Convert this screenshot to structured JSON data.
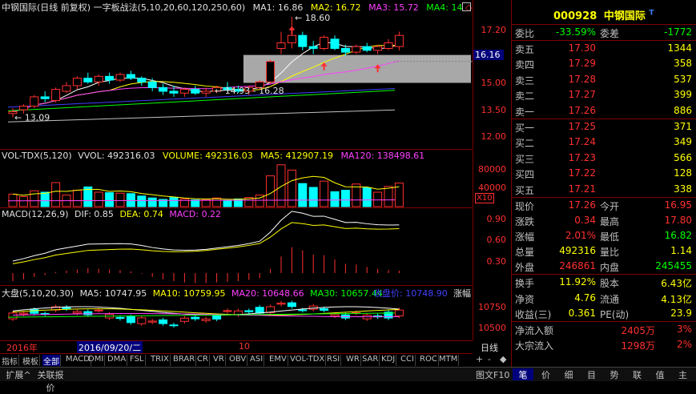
{
  "colors": {
    "up": "#ff3030",
    "down": "#00ffff",
    "ma5": "#ffffff",
    "ma10": "#ffff00",
    "ma20": "#ff40ff",
    "ma60": "#00ff00",
    "ma120": "#4040ff",
    "ma250": "#c0c0c0",
    "grid": "#800000"
  },
  "price_pane": {
    "header": "中钢国际(日线 前复权) 一字板战法(5,10,20,60,120,250,60)",
    "ma1": "MA1: 16.86",
    "ma2": "MA2: 16.72",
    "ma3": "MA3: 15.72",
    "ma4": "MA4: 14",
    "hi_label": "18.60",
    "range_label": "14.93 - 16.28",
    "low_label": "13.09",
    "current_tag": "16.16",
    "y_ticks": [
      "17.20",
      "16.16",
      "15.00",
      "13.50",
      "12.00"
    ]
  },
  "vol_pane": {
    "header": "VOL-TDX(5,120)",
    "vvol": "VVOL: 492316.03",
    "volume": "VOLUME: 492316.03",
    "ma5": "MA5: 412907.19",
    "ma120": "MA120: 138498.61",
    "y_ticks": [
      "80000",
      "40000"
    ],
    "unit": "X10"
  },
  "macd_pane": {
    "header": "MACD(12,26,9)",
    "dif": "DIF: 0.85",
    "dea": "DEA: 0.74",
    "macd": "MACD: 0.22",
    "y_ticks": [
      "0.90",
      "0.60",
      "0.30"
    ]
  },
  "index_pane": {
    "header": "大盘(5,10,20,30)",
    "ma5": "MA5: 10747.95",
    "ma10": "MA10: 10759.95",
    "ma20": "MA20: 10648.66",
    "ma30": "MA30: 10657.44",
    "close_label": "收盘价: 10748.90",
    "tail": "涨幅",
    "y_ticks": [
      "10750",
      "10500"
    ]
  },
  "time_axis": {
    "year": "2016年",
    "cursor_date": "2016/09/20/二",
    "month": "10",
    "period": "日线"
  },
  "indicator_tabs": [
    "指标",
    "模板",
    "全部",
    "MACD",
    "DMI",
    "DMA",
    "FSL",
    "TRIX",
    "BRAR",
    "CR",
    "VR",
    "OBV",
    "ASI",
    "EMV",
    "VOL-TDX",
    "RSI",
    "WR",
    "SAR",
    "KDJ",
    "CCI",
    "ROC",
    "MTM"
  ],
  "tab_controls": [
    "+",
    "-",
    "◆"
  ],
  "bottom_left": [
    "扩展^",
    "关联报价"
  ],
  "bottom_right_label": "图文F10",
  "bottom_tabs": [
    "笔",
    "价",
    "细",
    "目",
    "势",
    "联",
    "值",
    "主"
  ],
  "quote": {
    "code": "000928",
    "name": "中钢国际",
    "flag": "T",
    "weibi_label": "委比",
    "weibi": "-33.59%",
    "weicha_label": "委差",
    "weicha": "-1772",
    "asks": [
      {
        "label": "卖五",
        "price": "17.30",
        "vol": "1344"
      },
      {
        "label": "卖四",
        "price": "17.29",
        "vol": "358"
      },
      {
        "label": "卖三",
        "price": "17.28",
        "vol": "537"
      },
      {
        "label": "卖二",
        "price": "17.27",
        "vol": "399"
      },
      {
        "label": "卖一",
        "price": "17.26",
        "vol": "886"
      }
    ],
    "bids": [
      {
        "label": "买一",
        "price": "17.25",
        "vol": "371"
      },
      {
        "label": "买二",
        "price": "17.24",
        "vol": "349"
      },
      {
        "label": "买三",
        "price": "17.23",
        "vol": "566"
      },
      {
        "label": "买四",
        "price": "17.22",
        "vol": "128"
      },
      {
        "label": "买五",
        "price": "17.21",
        "vol": "338"
      }
    ],
    "stats": [
      {
        "l1": "现价",
        "v1": "17.26",
        "l2": "今开",
        "v2": "16.95",
        "c1": "#ff3030",
        "c2": "#ff3030"
      },
      {
        "l1": "涨跌",
        "v1": "0.34",
        "l2": "最高",
        "v2": "17.80",
        "c1": "#ff3030",
        "c2": "#ff3030"
      },
      {
        "l1": "涨幅",
        "v1": "2.01%",
        "l2": "最低",
        "v2": "16.82",
        "c1": "#ff3030",
        "c2": "#00ff00"
      },
      {
        "l1": "总量",
        "v1": "492316",
        "l2": "量比",
        "v2": "1.14",
        "c1": "#ffff00",
        "c2": "#ffff00"
      },
      {
        "l1": "外盘",
        "v1": "246861",
        "l2": "内盘",
        "v2": "245455",
        "c1": "#ff3030",
        "c2": "#00ff00"
      }
    ],
    "stats2": [
      {
        "l1": "换手",
        "v1": "11.92%",
        "l2": "股本",
        "v2": "6.43亿"
      },
      {
        "l1": "净资",
        "v1": "4.76",
        "l2": "流通",
        "v2": "4.13亿"
      },
      {
        "l1": "收益(三)",
        "v1": "0.361",
        "l2": "PE(动)",
        "v2": "23.9"
      }
    ],
    "flows": [
      {
        "label": "净流入额",
        "value": "2405万",
        "pct": "3%"
      },
      {
        "label": "大宗流入",
        "value": "1298万",
        "pct": "2%"
      }
    ]
  },
  "chart_data": [
    {
      "type": "candlestick",
      "name": "中钢国际 daily",
      "ohlc": [
        [
          13.4,
          13.7,
          13.2,
          13.5
        ],
        [
          13.6,
          13.9,
          13.4,
          13.8
        ],
        [
          13.8,
          14.4,
          13.7,
          14.3
        ],
        [
          14.3,
          14.6,
          14.0,
          14.2
        ],
        [
          14.1,
          14.8,
          14.0,
          14.7
        ],
        [
          14.6,
          15.1,
          14.5,
          14.9
        ],
        [
          14.9,
          15.4,
          14.7,
          15.3
        ],
        [
          15.3,
          15.6,
          15.0,
          15.1
        ],
        [
          15.1,
          15.5,
          14.9,
          15.4
        ],
        [
          15.4,
          15.6,
          15.0,
          15.2
        ],
        [
          15.2,
          15.6,
          15.1,
          15.5
        ],
        [
          15.5,
          15.7,
          15.2,
          15.3
        ],
        [
          15.3,
          15.4,
          14.9,
          15.1
        ],
        [
          15.1,
          15.3,
          14.6,
          14.8
        ],
        [
          14.8,
          15.0,
          14.4,
          14.6
        ],
        [
          14.6,
          14.9,
          14.3,
          14.5
        ],
        [
          14.5,
          14.8,
          14.3,
          14.7
        ],
        [
          14.7,
          14.9,
          14.4,
          14.5
        ],
        [
          14.5,
          14.8,
          14.3,
          14.6
        ],
        [
          14.6,
          14.9,
          14.5,
          14.8
        ],
        [
          14.8,
          15.1,
          14.6,
          14.7
        ],
        [
          14.7,
          14.9,
          14.5,
          14.6
        ],
        [
          14.6,
          14.9,
          14.4,
          14.8
        ],
        [
          14.8,
          15.2,
          14.7,
          15.1
        ],
        [
          15.1,
          16.3,
          15.0,
          16.2
        ],
        [
          16.9,
          17.8,
          16.6,
          17.2
        ],
        [
          17.2,
          18.6,
          16.9,
          17.6
        ],
        [
          17.6,
          17.8,
          16.8,
          17.0
        ],
        [
          17.0,
          17.3,
          16.6,
          16.9
        ],
        [
          16.9,
          17.6,
          16.8,
          17.5
        ],
        [
          17.4,
          17.6,
          16.8,
          16.9
        ],
        [
          16.9,
          17.1,
          16.5,
          16.7
        ],
        [
          16.7,
          17.1,
          16.6,
          17.0
        ],
        [
          17.0,
          17.2,
          16.7,
          16.8
        ],
        [
          16.8,
          17.1,
          16.6,
          17.0
        ],
        [
          16.9,
          17.4,
          16.8,
          17.2
        ],
        [
          17.0,
          17.8,
          16.8,
          17.6
        ]
      ],
      "ylim": [
        11.5,
        18.9
      ]
    },
    {
      "type": "bar",
      "name": "VOL-TDX",
      "values": [
        26000,
        21000,
        33000,
        30000,
        50000,
        24000,
        34000,
        41000,
        30000,
        29000,
        28000,
        27000,
        22000,
        18000,
        15000,
        19000,
        16000,
        14000,
        15000,
        18000,
        13000,
        16000,
        19000,
        24000,
        64000,
        87000,
        76000,
        48000,
        40000,
        53000,
        31000,
        34000,
        47000,
        39000,
        30000,
        42000,
        49000
      ],
      "ylim": [
        0,
        95000
      ]
    },
    {
      "type": "bar",
      "name": "MACD",
      "values": [
        0.05,
        0.08,
        0.12,
        0.15,
        0.2,
        0.22,
        0.24,
        0.26,
        0.25,
        0.24,
        0.23,
        0.21,
        0.17,
        0.12,
        0.08,
        0.05,
        0.03,
        0.02,
        0.02,
        0.03,
        0.04,
        0.05,
        0.07,
        0.1,
        0.25,
        0.45,
        0.6,
        0.55,
        0.48,
        0.47,
        0.4,
        0.33,
        0.32,
        0.28,
        0.25,
        0.23,
        0.22
      ],
      "ylim": [
        0,
        1.05
      ]
    },
    {
      "type": "candlestick",
      "name": "大盘",
      "ylim": [
        10430,
        10830
      ]
    }
  ]
}
